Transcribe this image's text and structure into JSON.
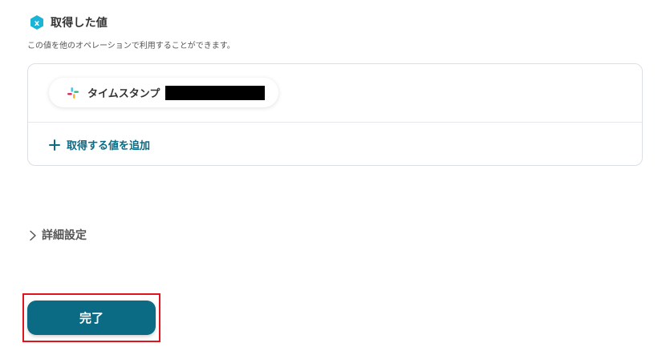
{
  "section": {
    "title": "取得した値",
    "description": "この値を他のオペレーションで利用することができます。"
  },
  "values_card": {
    "items": [
      {
        "label": "タイムスタンプ",
        "icon": "slack-icon"
      }
    ],
    "add_label": "取得する値を追加"
  },
  "advanced": {
    "label": "詳細設定"
  },
  "footer": {
    "done_label": "完了"
  },
  "colors": {
    "accent": "#0b6b84",
    "badge": "#1ab5d6",
    "highlight": "#e0141c"
  }
}
